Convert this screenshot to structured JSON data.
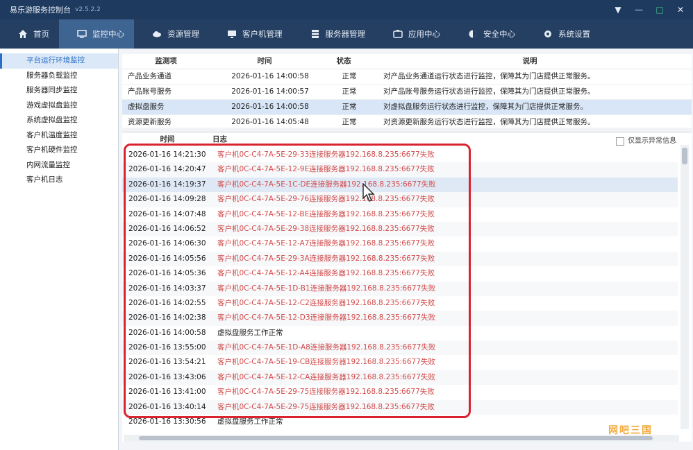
{
  "app": {
    "title": "易乐游服务控制台",
    "version": "v2.5.2.2"
  },
  "window_controls": [
    "▼",
    "—",
    "□",
    "✕"
  ],
  "nav": [
    {
      "label": "首页",
      "icon": "home-icon"
    },
    {
      "label": "监控中心",
      "icon": "monitor-icon",
      "active": true
    },
    {
      "label": "资源管理",
      "icon": "cloud-icon"
    },
    {
      "label": "客户机管理",
      "icon": "desktop-icon"
    },
    {
      "label": "服务器管理",
      "icon": "server-icon"
    },
    {
      "label": "应用中心",
      "icon": "apps-icon"
    },
    {
      "label": "安全中心",
      "icon": "shield-icon"
    },
    {
      "label": "系统设置",
      "icon": "gear-icon"
    }
  ],
  "sidebar": [
    {
      "label": "平台运行环境监控",
      "active": true
    },
    {
      "label": "服务器负载监控"
    },
    {
      "label": "服务器同步监控"
    },
    {
      "label": "游戏虚拟盘监控"
    },
    {
      "label": "系统虚拟盘监控"
    },
    {
      "label": "客户机温度监控"
    },
    {
      "label": "客户机硬件监控"
    },
    {
      "label": "内网流量监控"
    },
    {
      "label": "客户机日志"
    }
  ],
  "top_table": {
    "headers": [
      "监测项",
      "时间",
      "状态",
      "说明"
    ],
    "rows": [
      [
        "产品业务通道",
        "2026-01-16 14:00:58",
        "正常",
        "对产品业务通道运行状态进行监控，保障其为门店提供正常服务。"
      ],
      [
        "产品账号服务",
        "2026-01-16 14:00:57",
        "正常",
        "对产品账号服务运行状态进行监控，保障其为门店提供正常服务。"
      ],
      [
        "虚拟盘服务",
        "2026-01-16 14:00:58",
        "正常",
        "对虚拟盘服务运行状态进行监控，保障其为门店提供正常服务。"
      ],
      [
        "资源更新服务",
        "2026-01-16 14:05:48",
        "正常",
        "对资源更新服务运行状态进行监控，保障其为门店提供正常服务。"
      ]
    ],
    "selected_row": 2
  },
  "log": {
    "headers": [
      "时间",
      "日志"
    ],
    "only_errors_label": "仅显示异常信息",
    "only_errors_checked": false,
    "selected_row": 2,
    "rows": [
      {
        "time": "2026-01-16 14:21:30",
        "msg": "客户机0C-C4-7A-5E-29-33连接服务器192.168.8.235:6677失败",
        "error": true
      },
      {
        "time": "2026-01-16 14:20:47",
        "msg": "客户机0C-C4-7A-5E-12-9E连接服务器192.168.8.235:6677失败",
        "error": true
      },
      {
        "time": "2026-01-16 14:19:37",
        "msg": "客户机0C-C4-7A-5E-1C-DE连接服务器192.168.8.235:6677失败",
        "error": true
      },
      {
        "time": "2026-01-16 14:09:28",
        "msg": "客户机0C-C4-7A-5E-29-76连接服务器192.168.8.235:6677失败",
        "error": true
      },
      {
        "time": "2026-01-16 14:07:48",
        "msg": "客户机0C-C4-7A-5E-12-BE连接服务器192.168.8.235:6677失败",
        "error": true
      },
      {
        "time": "2026-01-16 14:06:52",
        "msg": "客户机0C-C4-7A-5E-29-38连接服务器192.168.8.235:6677失败",
        "error": true
      },
      {
        "time": "2026-01-16 14:06:30",
        "msg": "客户机0C-C4-7A-5E-12-A7连接服务器192.168.8.235:6677失败",
        "error": true
      },
      {
        "time": "2026-01-16 14:05:56",
        "msg": "客户机0C-C4-7A-5E-29-3A连接服务器192.168.8.235:6677失败",
        "error": true
      },
      {
        "time": "2026-01-16 14:05:36",
        "msg": "客户机0C-C4-7A-5E-12-A4连接服务器192.168.8.235:6677失败",
        "error": true
      },
      {
        "time": "2026-01-16 14:03:37",
        "msg": "客户机0C-C4-7A-5E-1D-B1连接服务器192.168.8.235:6677失败",
        "error": true
      },
      {
        "time": "2026-01-16 14:02:55",
        "msg": "客户机0C-C4-7A-5E-12-C2连接服务器192.168.8.235:6677失败",
        "error": true
      },
      {
        "time": "2026-01-16 14:02:38",
        "msg": "客户机0C-C4-7A-5E-12-D3连接服务器192.168.8.235:6677失败",
        "error": true
      },
      {
        "time": "2026-01-16 14:00:58",
        "msg": "虚拟盘服务工作正常",
        "error": false
      },
      {
        "time": "2026-01-16 13:55:00",
        "msg": "客户机0C-C4-7A-5E-1D-A8连接服务器192.168.8.235:6677失败",
        "error": true
      },
      {
        "time": "2026-01-16 13:54:21",
        "msg": "客户机0C-C4-7A-5E-19-CB连接服务器192.168.8.235:6677失败",
        "error": true
      },
      {
        "time": "2026-01-16 13:43:06",
        "msg": "客户机0C-C4-7A-5E-12-CA连接服务器192.168.8.235:6677失败",
        "error": true
      },
      {
        "time": "2026-01-16 13:41:00",
        "msg": "客户机0C-C4-7A-5E-29-75连接服务器192.168.8.235:6677失败",
        "error": true
      },
      {
        "time": "2026-01-16 13:40:14",
        "msg": "客户机0C-C4-7A-5E-29-75连接服务器192.168.8.235:6677失败",
        "error": true
      },
      {
        "time": "2026-01-16 13:30:56",
        "msg": "虚拟盘服务工作正常",
        "error": false
      }
    ]
  },
  "watermark": "网吧三国"
}
